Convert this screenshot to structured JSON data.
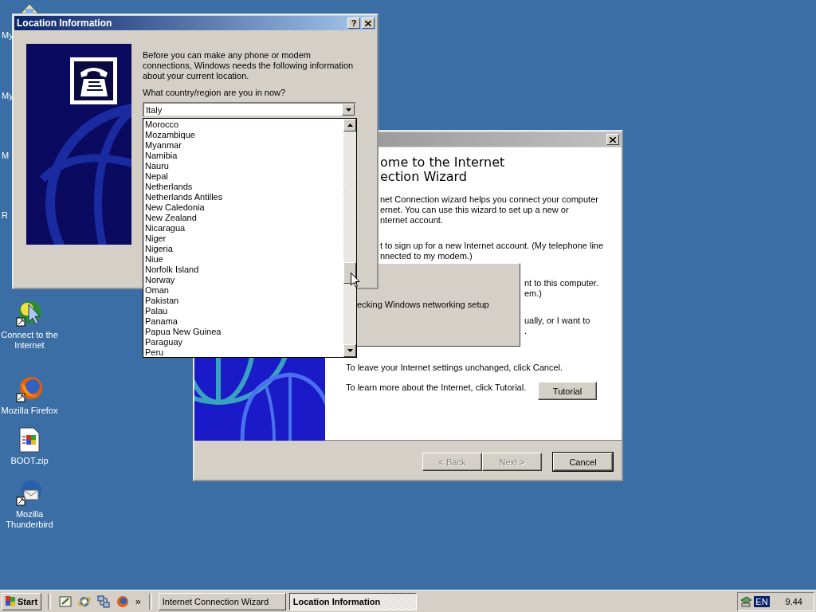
{
  "desktop": {
    "cut_labels": [
      "My",
      "My",
      "M",
      "R"
    ],
    "icons": [
      {
        "label": "Connect to the Internet",
        "kind": "connect"
      },
      {
        "label": "Mozilla Firefox",
        "kind": "firefox"
      },
      {
        "label": "BOOT.zip",
        "kind": "zip"
      },
      {
        "label": "Mozilla Thunderbird",
        "kind": "thunderbird"
      }
    ]
  },
  "wizard": {
    "active": false,
    "heading_lines": [
      "ome to the Internet",
      "ection Wizard"
    ],
    "intro_lines": [
      "net Connection wizard helps you connect your computer",
      "ernet.  You can use this wizard to set up a new or",
      "nternet account."
    ],
    "option_1_lines": [
      "t to sign up for a new Internet account. (My telephone line",
      "nnected to my modem.)"
    ],
    "option_2_lines": [
      "nt to this computer.",
      "em.)"
    ],
    "option_3_lines": [
      "ually, or I want to",
      "."
    ],
    "leave_text": "To leave your Internet settings unchanged, click Cancel.",
    "learn_text": "To learn more about the Internet, click Tutorial.",
    "tutorial_button": "Tutorial",
    "buttons": [
      {
        "label": "< Back",
        "kind": "back",
        "disabled": true
      },
      {
        "label": "Next >",
        "kind": "next",
        "disabled": true
      },
      {
        "label": "Cancel",
        "kind": "cancel",
        "disabled": false
      }
    ]
  },
  "progress": {
    "text": "ecking Windows networking setup"
  },
  "location": {
    "title": "Location Information",
    "active": true,
    "help": "?",
    "intro": "Before you can make any phone or modem connections, Windows needs the following information about your current location.",
    "question": "What country/region are you in now?",
    "country": "Italy",
    "list": [
      "Morocco",
      "Mozambique",
      "Myanmar",
      "Namibia",
      "Nauru",
      "Nepal",
      "Netherlands",
      "Netherlands Antilles",
      "New Caledonia",
      "New Zealand",
      "Nicaragua",
      "Niger",
      "Nigeria",
      "Niue",
      "Norfolk Island",
      "Norway",
      "Oman",
      "Pakistan",
      "Palau",
      "Panama",
      "Papua New Guinea",
      "Paraguay",
      "Peru"
    ]
  },
  "taskbar": {
    "start": "Start",
    "more": "»",
    "tasks": [
      {
        "label": "Internet Connection Wizard",
        "selected": false
      },
      {
        "label": "Location Information",
        "selected": true
      }
    ],
    "language": "EN",
    "clock": "9.44"
  }
}
